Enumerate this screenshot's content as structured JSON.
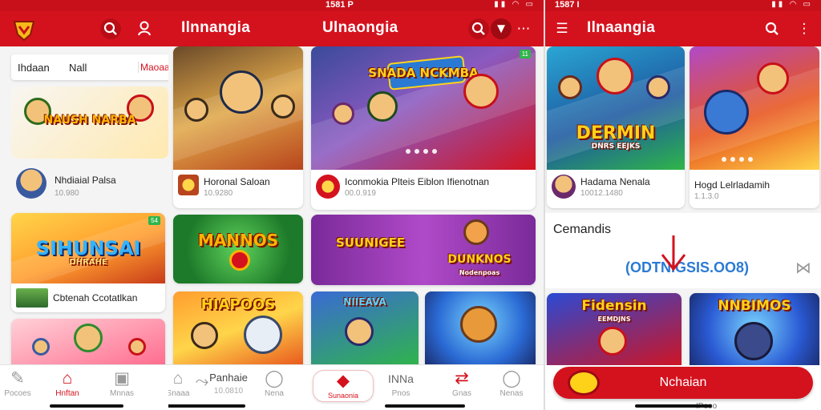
{
  "panels": [
    {
      "status_time": "",
      "title": "",
      "tabs": [
        "Ihdaan",
        "Nall",
        "Maoaa"
      ],
      "cards": [
        {
          "title": "NAUSH NARBA"
        },
        {
          "title": "SIHUNSAI",
          "sub": "DHRAHE",
          "badge": "54"
        },
        {
          "title": ""
        }
      ],
      "items": [
        {
          "name": "Nhdiaial Palsa",
          "sub": "10.980"
        },
        {
          "name": "Cbtenah Ccotatlkan",
          "sub": ""
        }
      ],
      "nav": [
        "Pocoes",
        "Hnftan",
        "Mnnas"
      ]
    },
    {
      "status_time": "",
      "title": "Ilnnangia",
      "cards": [
        {
          "title": ""
        },
        {
          "title": "MANNOS"
        },
        {
          "title": "HIAPOOS"
        }
      ],
      "items": [
        {
          "name": "Horonal Saloan",
          "sub": "10.9280"
        }
      ],
      "nav": [
        "Snaaa",
        "Panhaie",
        "Nena"
      ],
      "nav_sub": "10.0810"
    },
    {
      "status_time": "1581 P",
      "title": "Ulnaongia",
      "cards": [
        {
          "title": "SNADA NCKMBA",
          "badge": "11"
        },
        {
          "title": "SUUNIGEE"
        },
        {
          "title": "DUNKNOS",
          "sub": "Nodenpoas"
        },
        {
          "title": "NIIEAVA"
        },
        {
          "title": ""
        }
      ],
      "items": [
        {
          "name": "Iconmokia Plteis Eiblon Ifienotnan",
          "sub": "00.0.919"
        }
      ],
      "nav": [
        "Sunaonia",
        "INNa",
        "Pnos",
        "Gnas",
        "Nenas"
      ]
    },
    {
      "status_time": "1587 I",
      "title": "Ilnaangia",
      "cards": [
        {
          "title": "DERMIN",
          "sub": "DNRS EEJKS"
        },
        {
          "title": ""
        },
        {
          "title": "Fidensin",
          "sub": "EEMDJNS"
        },
        {
          "title": "NNBIMOS"
        }
      ],
      "items": [
        {
          "name": "Hadama Nenala",
          "sub": "10012.1480"
        },
        {
          "name": "Hogd Lelrladamih",
          "sub": "1.1.3.0"
        }
      ],
      "section": {
        "title": "Cemandis",
        "code": "(ODTNIGSIS.OO8)"
      },
      "cta": {
        "label": "Nchaian"
      },
      "footer_text": "IPooo"
    }
  ],
  "colors": {
    "brand": "#d4121e",
    "brand_dark": "#b80d16"
  }
}
